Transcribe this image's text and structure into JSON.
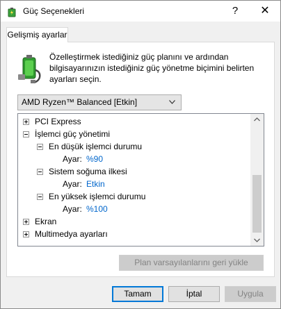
{
  "window": {
    "title": "Güç Seçenekleri",
    "help_glyph": "?",
    "close_glyph": "✕"
  },
  "tabs": [
    {
      "label": "Gelişmiş ayarlar"
    }
  ],
  "description": "Özelleştirmek istediğiniz güç planını ve ardından bilgisayarınızın istediğiniz güç yönetme biçimini belirten ayarları seçin.",
  "plan_select": {
    "value": "AMD Ryzen™ Balanced [Etkin]"
  },
  "tree": {
    "pci_express": "PCI Express",
    "processor_power": "İşlemci güç yönetimi",
    "min_processor_state": "En düşük işlemci durumu",
    "min_setting_label": "Ayar:",
    "min_setting_value": "%90",
    "cooling_policy": "Sistem soğuma ilkesi",
    "cooling_setting_label": "Ayar:",
    "cooling_setting_value": "Etkin",
    "max_processor_state": "En yüksek işlemci durumu",
    "max_setting_label": "Ayar:",
    "max_setting_value": "%100",
    "display": "Ekran",
    "multimedia": "Multimedya ayarları"
  },
  "buttons": {
    "restore_defaults": "Plan varsayılanlarını geri yükle",
    "ok": "Tamam",
    "cancel": "İptal",
    "apply": "Uygula"
  },
  "colors": {
    "setting_value": "#0066cc",
    "default_button_border": "#0078d7"
  },
  "icons": [
    "power-options-icon",
    "help-icon",
    "close-icon",
    "battery-plug-icon",
    "chevron-down-icon",
    "expand-icon",
    "collapse-icon",
    "scroll-up-icon",
    "scroll-down-icon"
  ]
}
